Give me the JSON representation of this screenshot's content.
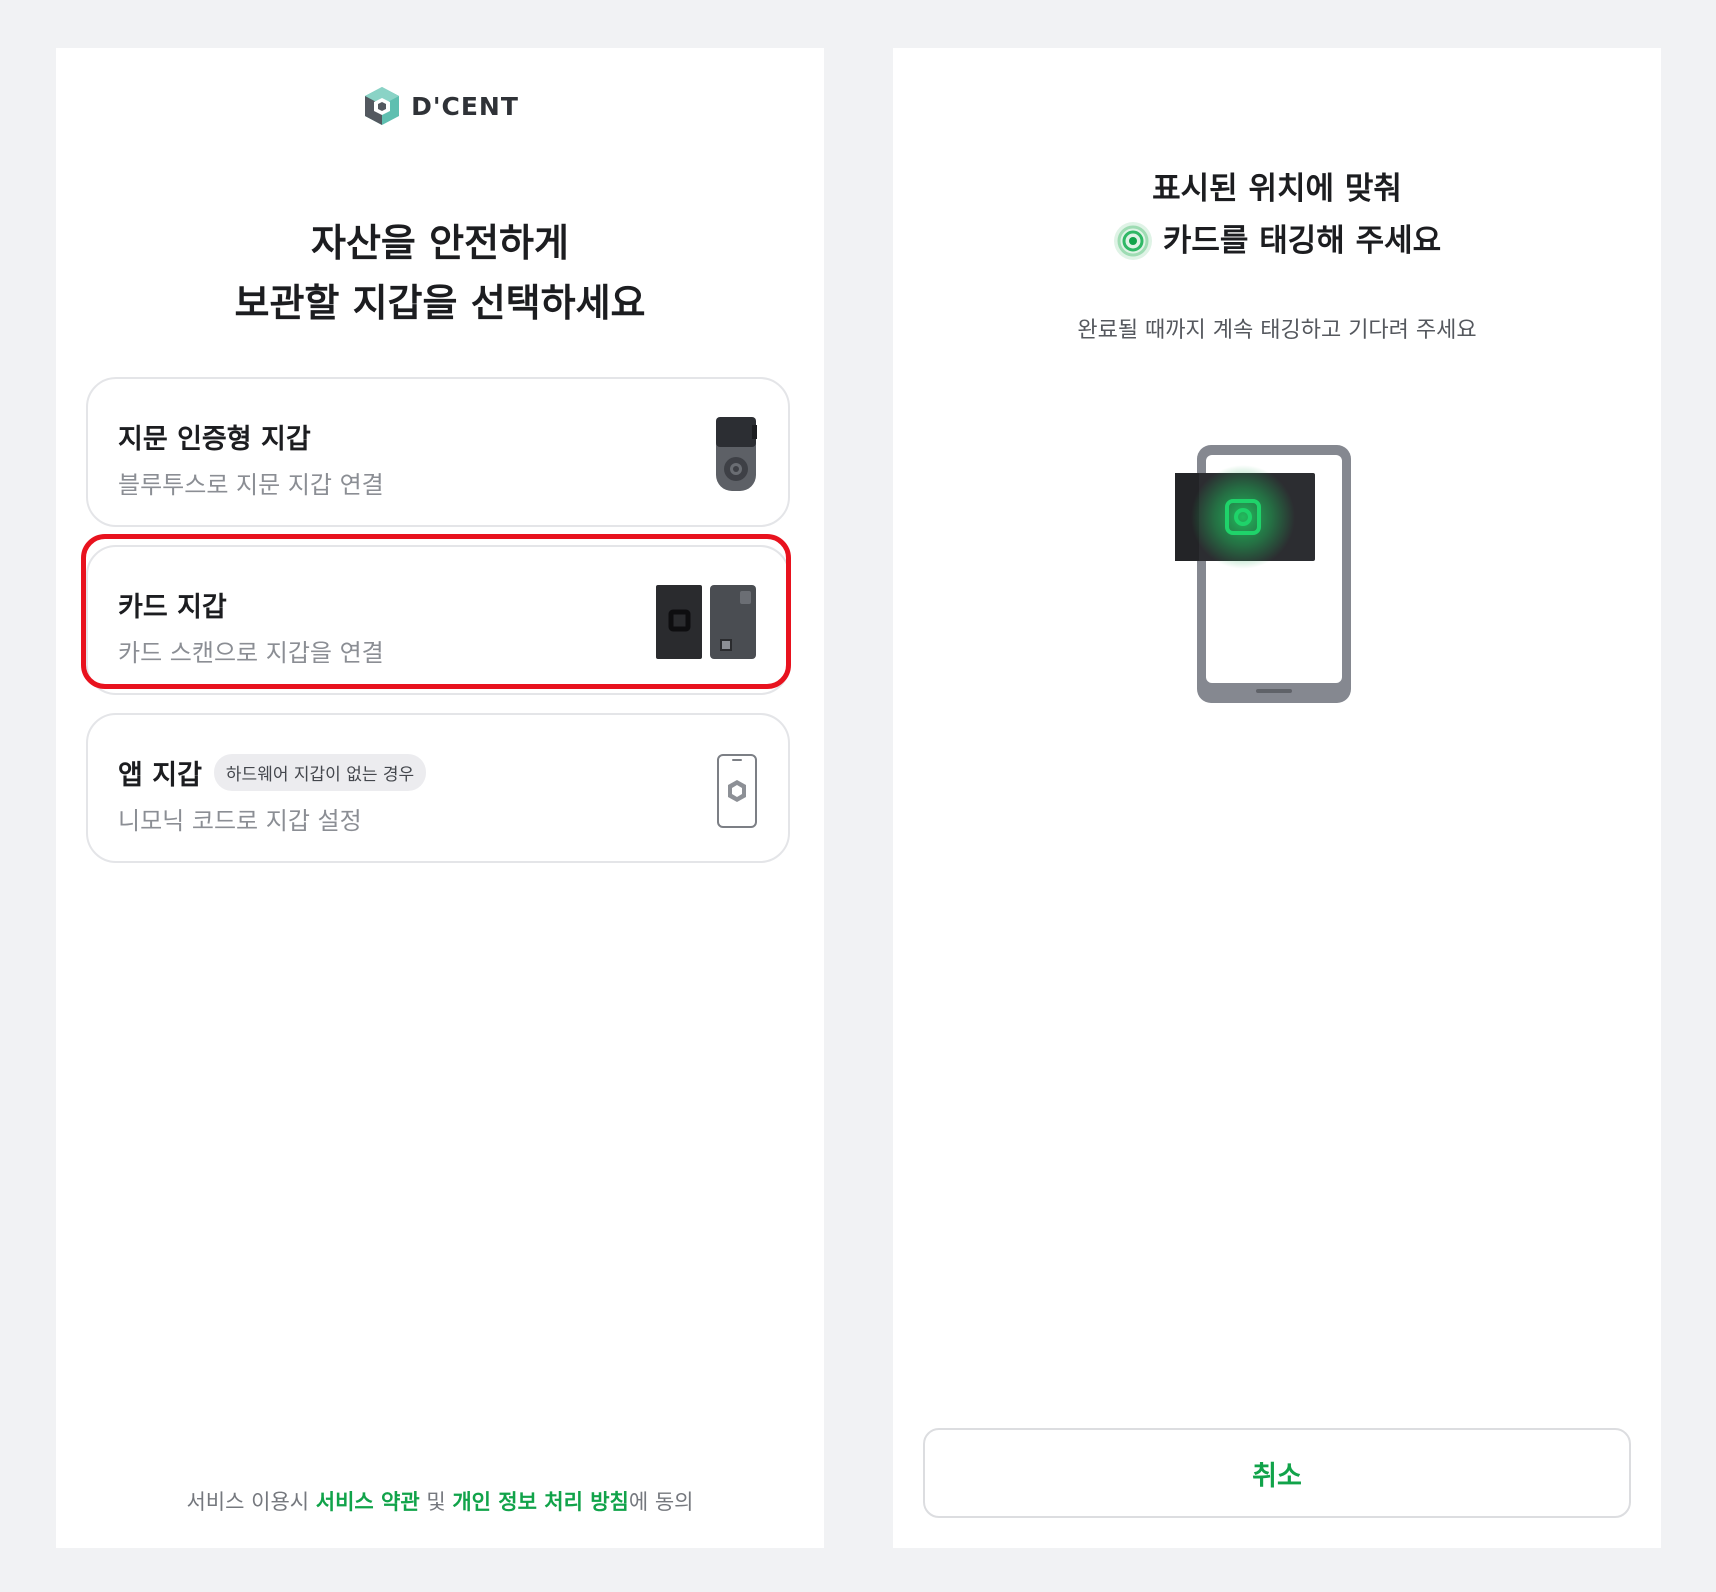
{
  "left_screen": {
    "logo": {
      "text": "D'CENT",
      "icon": "dcent-logo-icon"
    },
    "heading": {
      "line1": "자산을 안전하게",
      "line2": "보관할 지갑을 선택하세요"
    },
    "options": [
      {
        "title": "지문 인증형 지갑",
        "subtitle": "블루투스로 지문 지갑 연결",
        "image": "biometric-wallet-device-icon"
      },
      {
        "title": "카드 지갑",
        "subtitle": "카드 스캔으로 지갑을 연결",
        "image": "card-wallet-icon",
        "highlighted": true
      },
      {
        "title": "앱 지갑",
        "badge": "하드웨어 지갑이 없는 경우",
        "subtitle": "니모닉 코드로 지갑 설정",
        "image": "phone-app-icon"
      }
    ],
    "footer": {
      "prefix": "서비스 이용시 ",
      "terms_link": "서비스 약관",
      "and": " 및 ",
      "privacy_link": "개인 정보 처리 방침",
      "suffix": "에 동의"
    }
  },
  "right_screen": {
    "title_line1": "표시된 위치에 맞춰",
    "title_line2": "카드를 태깅해 주세요",
    "subtitle": "완료될 때까지 계속 태깅하고 기다려 주세요",
    "illustration": "phone-card-tap-illustration",
    "cancel_button": "취소"
  },
  "colors": {
    "accent": "#11a34a",
    "highlight": "#e8121e",
    "background": "#f1f2f4"
  }
}
